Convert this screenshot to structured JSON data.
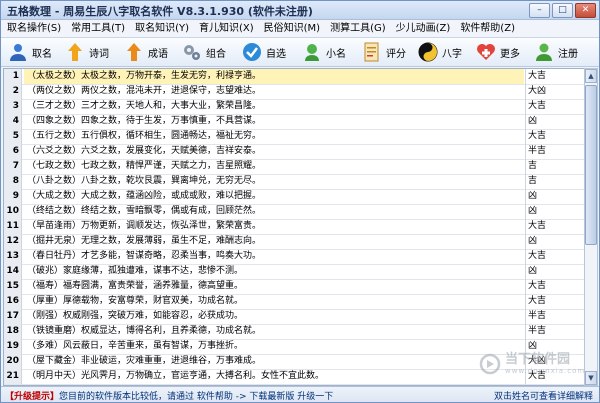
{
  "window": {
    "title": "五格数理 - 周易生辰八字取名软件 V8.3.1.930 (软件未注册)"
  },
  "menu": [
    "取名操作(S)",
    "常用工具(T)",
    "取名知识(Y)",
    "育儿知识(X)",
    "民俗知识(M)",
    "测算工具(G)",
    "少儿动画(Z)",
    "软件帮助(Z)"
  ],
  "toolbar": {
    "items": [
      {
        "label": "取名",
        "icon": "person-icon"
      },
      {
        "label": "诗词",
        "icon": "scroll-icon"
      },
      {
        "label": "成语",
        "icon": "book-icon"
      },
      {
        "label": "组合",
        "icon": "gears-icon"
      },
      {
        "label": "自选",
        "icon": "checkmark-icon"
      },
      {
        "label": "小名",
        "icon": "baby-icon"
      },
      {
        "label": "评分",
        "icon": "document-icon"
      },
      {
        "label": "八字",
        "icon": "yinyang-icon"
      },
      {
        "label": "更多",
        "icon": "heart-plus-icon"
      },
      {
        "label": "注册",
        "icon": "user-register-icon"
      }
    ]
  },
  "table": {
    "rows": [
      {
        "no": "1",
        "desc": "（太极之数）太极之数，万物开泰，生发无穷，利禄亨通。",
        "result": "大吉",
        "selected": true
      },
      {
        "no": "2",
        "desc": "（两仪之数）两仪之数，混沌未开，进退保守，志望难达。",
        "result": "大凶"
      },
      {
        "no": "3",
        "desc": "（三才之数）三才之数，天地人和，大事大业，繁荣昌隆。",
        "result": "大吉"
      },
      {
        "no": "4",
        "desc": "（四象之数）四象之数，待于生发，万事慎重，不具营谋。",
        "result": "凶"
      },
      {
        "no": "5",
        "desc": "（五行之数）五行俱权，循环相生，圆通畅达，福祉无穷。",
        "result": "大吉"
      },
      {
        "no": "6",
        "desc": "（六爻之数）六爻之数，发展变化，天赋美德，吉祥安泰。",
        "result": "半吉"
      },
      {
        "no": "7",
        "desc": "（七政之数）七政之数，精悍严谨，天赋之力，吉星照耀。",
        "result": "吉"
      },
      {
        "no": "8",
        "desc": "（八卦之数）八卦之数，乾坎艮震，巽离坤兑，无穷无尽。",
        "result": "吉"
      },
      {
        "no": "9",
        "desc": "（大成之数）大成之数，蕴涵凶险，或成或败，难以把握。",
        "result": "凶"
      },
      {
        "no": "10",
        "desc": "（终结之数）终结之数，雪暗飘零，偶或有成，回顾茫然。",
        "result": "凶"
      },
      {
        "no": "11",
        "desc": "（旱苗逢雨）万物更新，调顺发达，恢弘泽世，繁荣富贵。",
        "result": "大吉"
      },
      {
        "no": "12",
        "desc": "（掘井无泉）无理之数，发展薄弱，虽生不足，难酬志向。",
        "result": "凶"
      },
      {
        "no": "13",
        "desc": "（春日牡丹）才艺多能，智谋奇略，忍柔当事，鸣奏大功。",
        "result": "大吉"
      },
      {
        "no": "14",
        "desc": "（破兆）家庭缘薄，孤独遭难，谋事不达，悲惨不测。",
        "result": "凶"
      },
      {
        "no": "15",
        "desc": "（福寿）福寿圆满，富贵荣誉，涵养雅量，德高望重。",
        "result": "大吉"
      },
      {
        "no": "16",
        "desc": "（厚重）厚德载物，安富尊荣，财官双美，功成名就。",
        "result": "大吉"
      },
      {
        "no": "17",
        "desc": "（刚强）权威刚强，突破万难，如能容忍，必获成功。",
        "result": "半吉"
      },
      {
        "no": "18",
        "desc": "（铁镜重磨）权威显达，博得名利，且养柔德，功成名就。",
        "result": "半吉"
      },
      {
        "no": "19",
        "desc": "（多难）风云蔽日，辛苦重来，虽有智谋，万事挫折。",
        "result": "凶"
      },
      {
        "no": "20",
        "desc": "（屋下藏金）非业破运，灾难重重，进退维谷，万事难成。",
        "result": "大凶"
      },
      {
        "no": "21",
        "desc": "（明月中天）光风霁月，万物确立，官运亨通，大搏名利。女性不宜此数。",
        "result": "大吉"
      }
    ]
  },
  "status": {
    "prefix": "【升级提示】",
    "message": "您目前的软件版本比较低，请通过 软件帮助 -> 下载最新版 升级一下",
    "hint": "双击姓名可查看详细解释"
  },
  "watermark": {
    "text": "当下软件园",
    "sub": "www.downxia.com"
  },
  "colors": {
    "accent": "#1d3a6b",
    "selected_row": "#fff3b8"
  }
}
